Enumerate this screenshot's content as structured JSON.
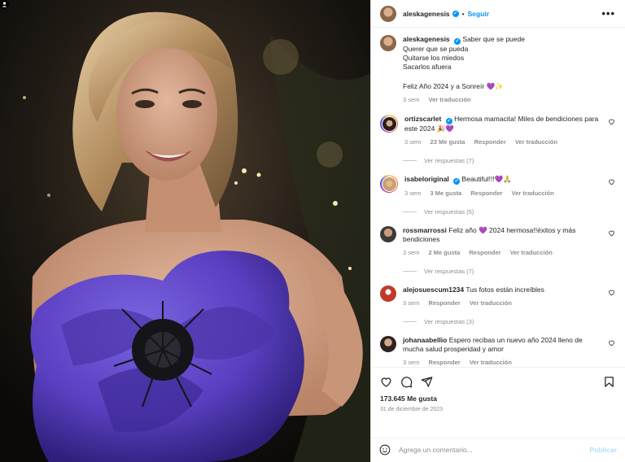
{
  "post": {
    "username": "aleskagenesis",
    "follow_label": "Seguir",
    "more_label": "•••",
    "caption": {
      "first_line": "Saber que se puede",
      "lines": [
        "Querer que se pueda",
        "Quitarse los miedos",
        "Sacarlos afuera"
      ],
      "closing": "Feliz Año 2024 y a Sonreír 💜✨",
      "time": "3 sem",
      "translate": "Ver traducción"
    }
  },
  "comments": [
    {
      "username": "ortizscarlet",
      "verified": true,
      "text": "Hermosa mamacita! Miles de bendiciones para este 2024 🎉💜",
      "time": "3 sem",
      "likes": "23 Me gusta",
      "reply": "Responder",
      "translate": "Ver traducción",
      "replies_label": "Ver respuestas (7)"
    },
    {
      "username": "isabeloriginal",
      "verified": true,
      "text": "Beautiful!!!💜🙏",
      "time": "3 sem",
      "likes": "3 Me gusta",
      "reply": "Responder",
      "translate": "Ver traducción",
      "replies_label": "Ver respuestas (5)"
    },
    {
      "username": "rossmarrossi",
      "verified": false,
      "text": "Feliz año 💜 2024 hermosa!!éxitos y más bendiciones",
      "time": "3 sem",
      "likes": "2 Me gusta",
      "reply": "Responder",
      "translate": "Ver traducción",
      "replies_label": "Ver respuestas (7)"
    },
    {
      "username": "alejosuescum1234",
      "verified": false,
      "text": "Tus fotos están increíbles",
      "time": "3 sem",
      "likes": "",
      "reply": "Responder",
      "translate": "Ver traducción",
      "replies_label": "Ver respuestas (3)"
    },
    {
      "username": "johanaabellio",
      "verified": false,
      "text": "Espero recibas un nuevo año 2024 lleno de mucha salud prosperidad y amor",
      "time": "3 sem",
      "likes": "",
      "reply": "Responder",
      "translate": "Ver traducción",
      "replies_label": ""
    }
  ],
  "actions": {
    "likes": "173.645 Me gusta",
    "date": "31 de diciembre de 2023"
  },
  "composer": {
    "placeholder": "Agrega un comentario...",
    "publish_label": "Publicar"
  },
  "colors": {
    "accent": "#0095f6",
    "publish_disabled": "#b2dffc",
    "dress": "#5a3fc0"
  },
  "icons": [
    "heart-icon",
    "comment-icon",
    "share-icon",
    "bookmark-icon",
    "emoji-icon",
    "more-icon",
    "user-tag-icon",
    "verified-icon"
  ]
}
